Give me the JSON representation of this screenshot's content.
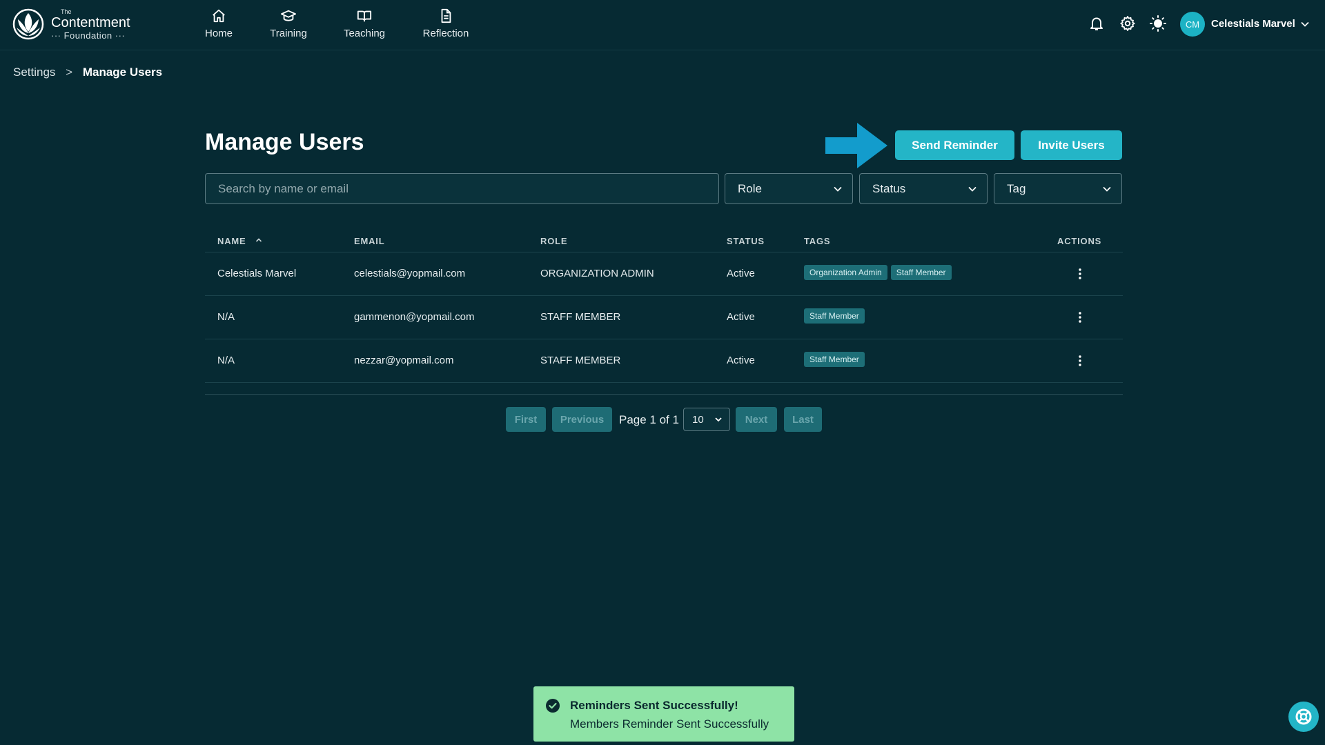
{
  "logo": {
    "the": "The",
    "name": "Contentment",
    "sub": "··· Foundation ···"
  },
  "nav": {
    "home": "Home",
    "training": "Training",
    "teaching": "Teaching",
    "reflection": "Reflection"
  },
  "user": {
    "initials": "CM",
    "name": "Celestials Marvel"
  },
  "breadcrumb": {
    "parent": "Settings",
    "separator": ">",
    "current": "Manage Users"
  },
  "page": {
    "title": "Manage Users",
    "send_reminder": "Send Reminder",
    "invite_users": "Invite Users"
  },
  "filters": {
    "search_placeholder": "Search by name or email",
    "role": "Role",
    "status": "Status",
    "tag": "Tag"
  },
  "table": {
    "headers": {
      "name": "NAME",
      "email": "EMAIL",
      "role": "ROLE",
      "status": "STATUS",
      "tags": "TAGS",
      "actions": "ACTIONS"
    },
    "rows": [
      {
        "name": "Celestials Marvel",
        "email": "celestials@yopmail.com",
        "role": "ORGANIZATION ADMIN",
        "status": "Active",
        "tags": [
          "Organization Admin",
          "Staff Member"
        ]
      },
      {
        "name": "N/A",
        "email": "gammenon@yopmail.com",
        "role": "STAFF MEMBER",
        "status": "Active",
        "tags": [
          "Staff Member"
        ]
      },
      {
        "name": "N/A",
        "email": "nezzar@yopmail.com",
        "role": "STAFF MEMBER",
        "status": "Active",
        "tags": [
          "Staff Member"
        ]
      }
    ]
  },
  "pagination": {
    "first": "First",
    "previous": "Previous",
    "page_text": "Page 1 of 1",
    "page_size": "10",
    "next": "Next",
    "last": "Last"
  },
  "toast": {
    "title": "Reminders Sent Successfully!",
    "message": "Members Reminder Sent Successfully"
  },
  "colors": {
    "background": "#062a33",
    "accent": "#24b5c7",
    "tag": "#1d6e77",
    "toast": "#8ee3a6",
    "arrow": "#139ccc"
  },
  "icons": {
    "nav": [
      "home-icon",
      "graduation-cap-icon",
      "open-book-icon",
      "document-icon"
    ],
    "top_right": [
      "bell-icon",
      "gear-icon",
      "sun-icon",
      "chevron-down-icon"
    ],
    "help": "lifebuoy-icon"
  }
}
